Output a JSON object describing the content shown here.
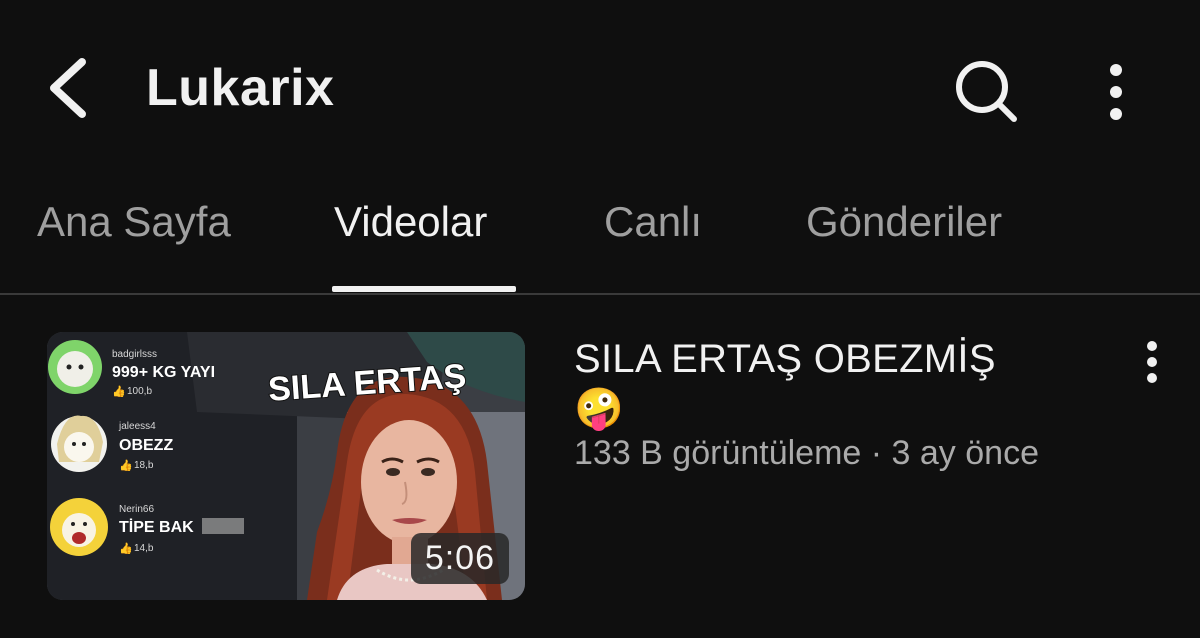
{
  "header": {
    "back_icon": "chevron-left-icon",
    "title": "Lukarix",
    "search_icon": "search-icon",
    "more_icon": "more-vertical-icon"
  },
  "tabs": [
    {
      "label": "Ana Sayfa",
      "active": false
    },
    {
      "label": "Videolar",
      "active": true
    },
    {
      "label": "Canlı",
      "active": false
    },
    {
      "label": "Gönderiler",
      "active": false
    }
  ],
  "video": {
    "title": "SILA ERTAŞ OBEZMİŞ",
    "title_emoji": "🤪",
    "views": "133 B görüntüleme",
    "separator": "·",
    "age": "3 ay önce",
    "duration": "5:06",
    "more_icon": "more-vertical-icon",
    "thumbnail": {
      "headline": "SILA ERTAŞ",
      "comments": [
        {
          "user": "badgirlsss",
          "text": "999+ KG YAYI",
          "likes": "100,b"
        },
        {
          "user": "jaleess4",
          "text": "OBEZZ",
          "likes": "18,b"
        },
        {
          "user": "Nerin66",
          "text": "TİPE BAK",
          "likes": "14,b"
        }
      ]
    }
  },
  "colors": {
    "background": "#0f0f0f",
    "text_primary": "#f1f1f1",
    "text_secondary": "#aaaaaa",
    "tab_inactive": "#9f9f9f",
    "divider": "#3a3a3a"
  }
}
